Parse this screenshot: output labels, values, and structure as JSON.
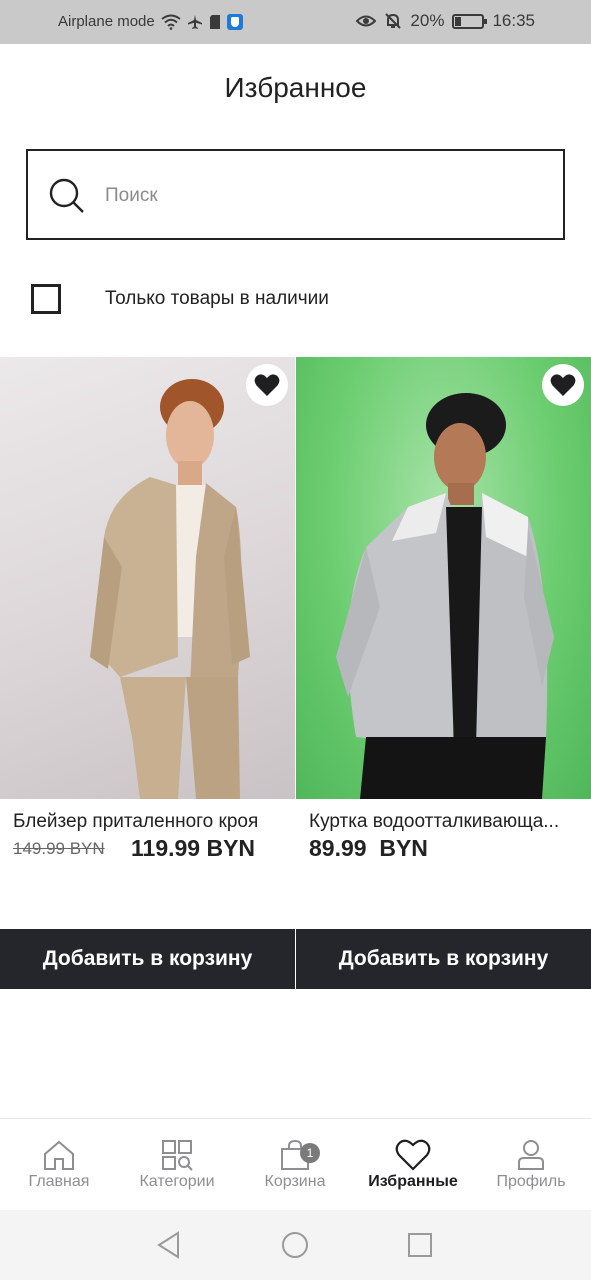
{
  "status_bar": {
    "airplane_label": "Airplane mode",
    "battery": "20%",
    "time": "16:35",
    "icons": [
      "wifi-icon",
      "airplane-icon",
      "sim-icon",
      "vpn-icon",
      "eye-icon",
      "bell-off-icon",
      "battery-icon"
    ]
  },
  "header": {
    "title": "Избранное"
  },
  "search": {
    "placeholder": "Поиск",
    "value": ""
  },
  "filter": {
    "in_stock_label": "Только товары в наличии",
    "checked": false
  },
  "products": [
    {
      "name": "Блейзер приталенного кроя",
      "old_price": "149.99 BYN",
      "price": "119.99 BYN",
      "favorite": true,
      "image_icon": "blazer-photo"
    },
    {
      "name": "Куртка водоотталкивающа...",
      "old_price": "",
      "price": "89.99  BYN",
      "favorite": true,
      "image_icon": "jacket-photo"
    }
  ],
  "add_to_cart_label": "Добавить в корзину",
  "bottom_nav": [
    {
      "label": "Главная",
      "icon": "home-icon",
      "active": false
    },
    {
      "label": "Категории",
      "icon": "categories-icon",
      "active": false
    },
    {
      "label": "Корзина",
      "icon": "cart-icon",
      "active": false,
      "badge": "1"
    },
    {
      "label": "Избранные",
      "icon": "heart-icon",
      "active": true
    },
    {
      "label": "Профиль",
      "icon": "profile-icon",
      "active": false
    }
  ],
  "colors": {
    "primary_dark": "#25262b",
    "background": "#ffffff",
    "status_bar": "#c9c9c9",
    "inactive_nav": "#8e8e93"
  }
}
